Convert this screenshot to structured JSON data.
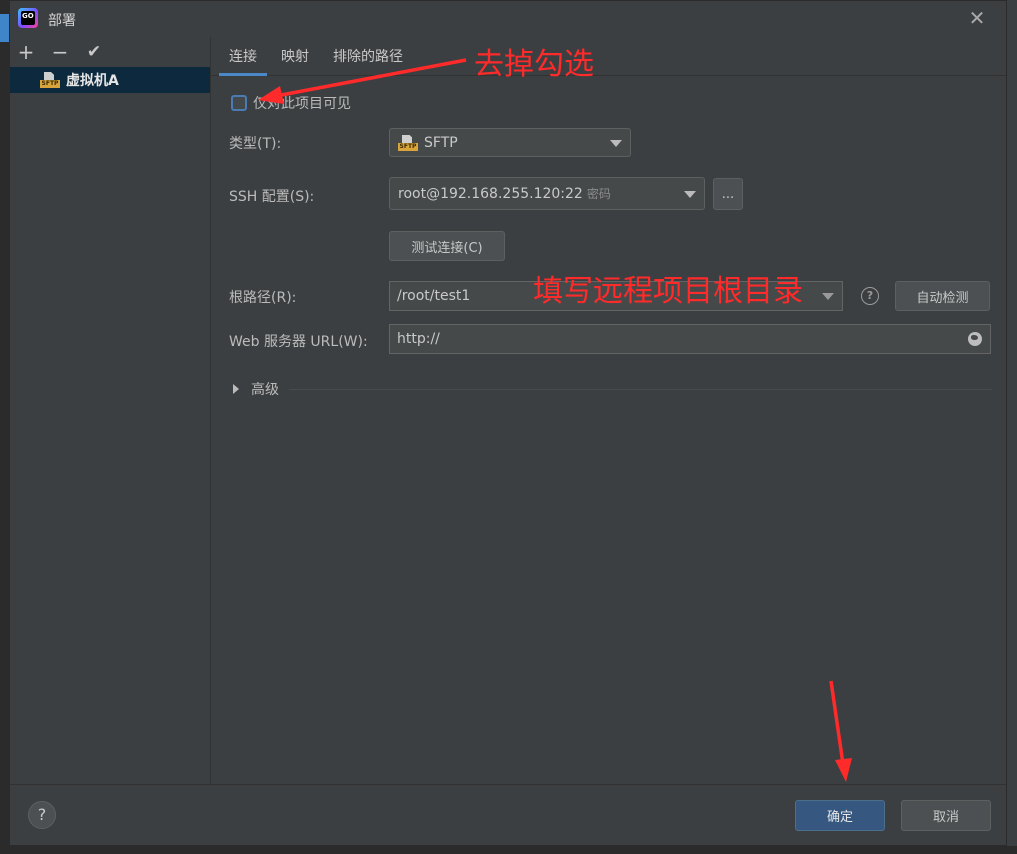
{
  "window": {
    "title": "部署"
  },
  "left_toolbar": {
    "add": "+",
    "remove": "−",
    "check": "✔"
  },
  "servers": [
    {
      "name": "虚拟机A",
      "icon": "sftp-icon",
      "icon_tag": "SFTP"
    }
  ],
  "tabs": [
    {
      "label": "连接",
      "active": true
    },
    {
      "label": "映射",
      "active": false
    },
    {
      "label": "排除的路径",
      "active": false
    }
  ],
  "connection": {
    "visible_only_label": "仅对此项目可见",
    "visible_only_checked": false,
    "type_label": "类型(T):",
    "type_value": "SFTP",
    "ssh_label": "SSH 配置(S):",
    "ssh_value": "root@192.168.255.120:22",
    "ssh_auth": "密码",
    "ssh_more": "...",
    "test_button": "测试连接(C)",
    "root_label": "根路径(R):",
    "root_value": "/root/test1",
    "help": "?",
    "autodetect_button": "自动检测",
    "web_label": "Web 服务器 URL(W):",
    "web_value": "http://",
    "advanced_label": "高级"
  },
  "footer": {
    "help": "?",
    "ok": "确定",
    "cancel": "取消"
  },
  "annotations": {
    "uncheck_note": "去掉勾选",
    "root_note": "填写远程项目根目录",
    "color": "#ff2a2a"
  }
}
